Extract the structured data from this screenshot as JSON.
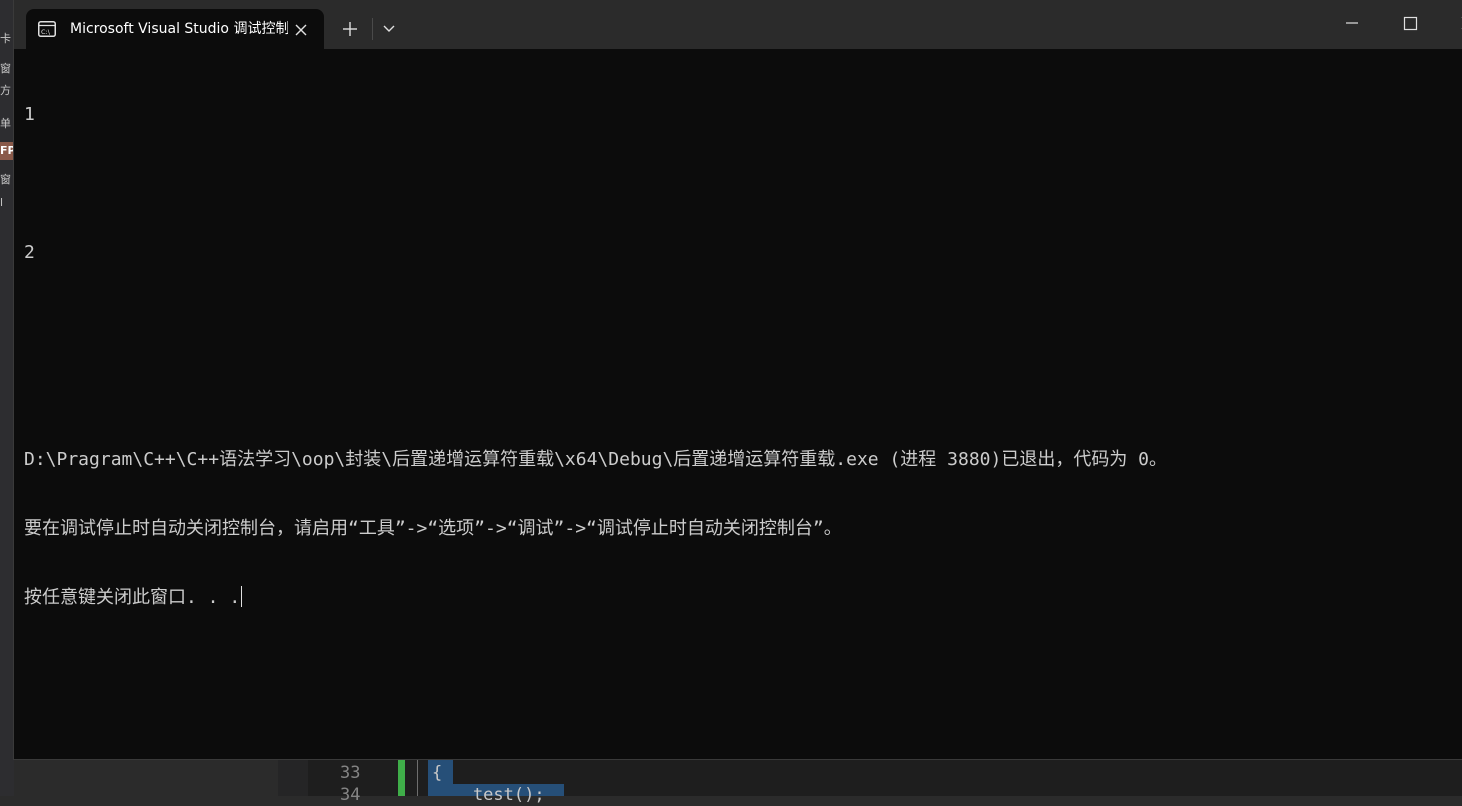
{
  "window": {
    "tab_title": "Microsoft Visual Studio 调试控制台",
    "tab_icon": "console-icon",
    "close_tab_icon": "close-icon",
    "new_tab_label": "+",
    "dropdown_icon": "chevron-down-icon",
    "minimize_icon": "minimize-icon",
    "maximize_icon": "maximize-icon",
    "close_window_icon": "close-icon"
  },
  "console": {
    "lines": [
      "1",
      "",
      "2",
      "",
      "",
      "D:\\Pragram\\C++\\C++语法学习\\oop\\封装\\后置递增运算符重载\\x64\\Debug\\后置递增运算符重载.exe (进程 3880)已退出，代码为 0。",
      "要在调试停止时自动关闭控制台，请启用“工具”->“选项”->“调试”->“调试停止时自动关闭控制台”。",
      "按任意键关闭此窗口. . ."
    ]
  },
  "background_ide": {
    "left_fragments": [
      "卡",
      "窗",
      "方",
      "单",
      "FP",
      "窗",
      "l"
    ],
    "line_numbers": [
      "33",
      "34"
    ],
    "code_lines": [
      "{",
      "    test();"
    ]
  },
  "colors": {
    "console_bg": "#0c0c0c",
    "console_text": "#cccccc",
    "titlebar_bg": "#2b2b2b",
    "change_bar": "#3fae49",
    "selection": "#264f78"
  }
}
